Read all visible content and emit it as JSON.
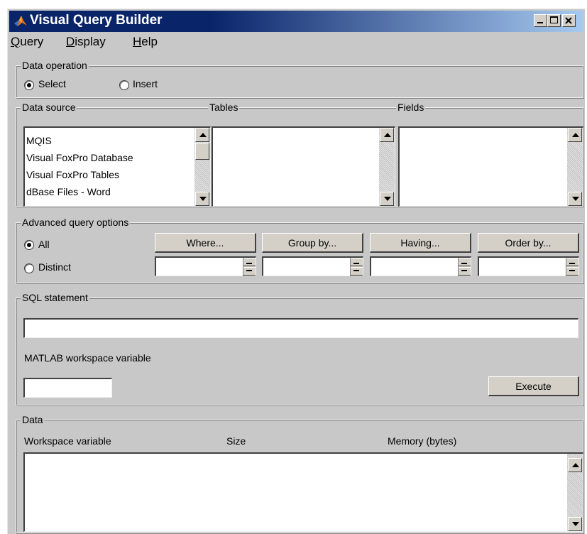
{
  "window": {
    "title": "Visual Query Builder"
  },
  "menu": [
    {
      "label": "Query"
    },
    {
      "label": "Display"
    },
    {
      "label": "Help"
    }
  ],
  "data_operation": {
    "label": "Data operation",
    "options": [
      {
        "label": "Select",
        "selected": true
      },
      {
        "label": "Insert",
        "selected": false
      }
    ]
  },
  "data_source": {
    "label": "Data source",
    "items": [
      "MQIS",
      "Visual FoxPro Database",
      "Visual FoxPro Tables",
      "dBase Files - Word"
    ]
  },
  "tables": {
    "label": "Tables",
    "items": []
  },
  "fields": {
    "label": "Fields",
    "items": []
  },
  "advanced": {
    "label": "Advanced query options",
    "options": [
      {
        "label": "All",
        "selected": true
      },
      {
        "label": "Distinct",
        "selected": false
      }
    ],
    "buttons": [
      {
        "label": "Where..."
      },
      {
        "label": "Group by..."
      },
      {
        "label": "Having..."
      },
      {
        "label": "Order by..."
      }
    ]
  },
  "sql": {
    "label": "SQL statement",
    "statement_value": "",
    "workspace_label": "MATLAB workspace variable",
    "workspace_value": "",
    "execute_label": "Execute"
  },
  "data": {
    "label": "Data",
    "columns": [
      "Workspace variable",
      "Size",
      "Memory (bytes)"
    ]
  }
}
